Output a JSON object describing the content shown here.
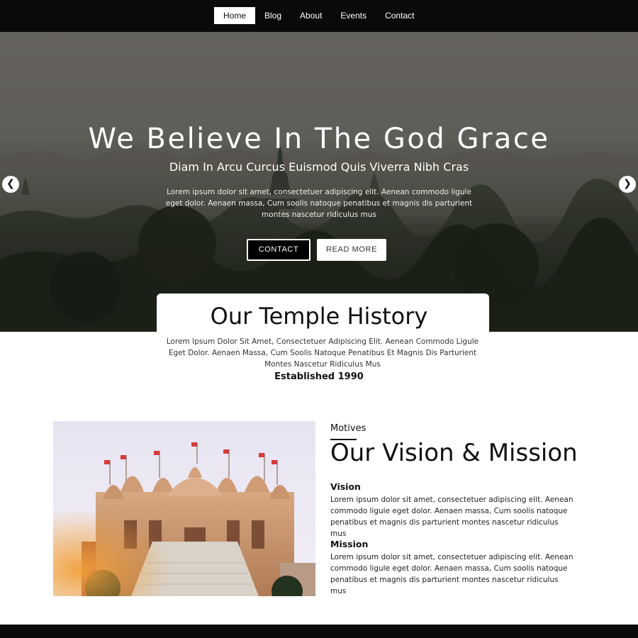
{
  "nav": {
    "items": [
      {
        "label": "Home",
        "active": true
      },
      {
        "label": "Blog",
        "active": false
      },
      {
        "label": "About",
        "active": false
      },
      {
        "label": "Events",
        "active": false
      },
      {
        "label": "Contact",
        "active": false
      }
    ]
  },
  "hero": {
    "title": "We Believe In The God Grace",
    "subtitle": "Diam In Arcu Curcus Euismod Quis Viverra Nibh Cras",
    "description": "Lorem ipsum dolor sit amet, consectetuer adipiscing elit. Aenean commodo ligule eget dolor. Aenaen massa, Cum soolis natoque penatibus et magnis dis parturient montes nascetur ridiculus mus",
    "contact_button": "CONTACT",
    "read_more_button": "READ MORE",
    "prev_arrow": "❮",
    "next_arrow": "❯"
  },
  "history": {
    "title": "Our Temple History",
    "text": "Lorem Ipsum Dolor Sit Amet, Consectetuer Adipiscing Elit. Aenean Commodo Ligule Eget Dolor. Aenaen Massa, Cum Soolis Natoque Penatibus Et Magnis Dis Parturient Montes Nascetur Ridiculus Mus",
    "established": "Established 1990"
  },
  "vision_mission": {
    "eyebrow": "Motives",
    "title": "Our Vision & Mission",
    "vision_heading": "Vision",
    "vision_text": "Lorem ipsum dolor sit amet, consectetuer adipiscing elit. Aenean commodo ligule eget dolor. Aenaen massa, Cum soolis natoque penatibus et magnis dis parturient montes nascetur ridiculus mus",
    "mission_heading": "Mission",
    "mission_text": "Lorem ipsum dolor sit amet, consectetuer adipiscing elit. Aenean commodo ligule eget dolor. Aenaen massa, Cum soolis natoque penatibus et magnis dis parturient montes nascetur ridiculus mus"
  },
  "colors": {
    "nav_background": "#0a0a0a",
    "accent_dark": "#000000",
    "text_light": "#ffffff"
  },
  "images": {
    "hero_background": "misty-temple-landscape",
    "section_image": "temple-with-flags"
  }
}
